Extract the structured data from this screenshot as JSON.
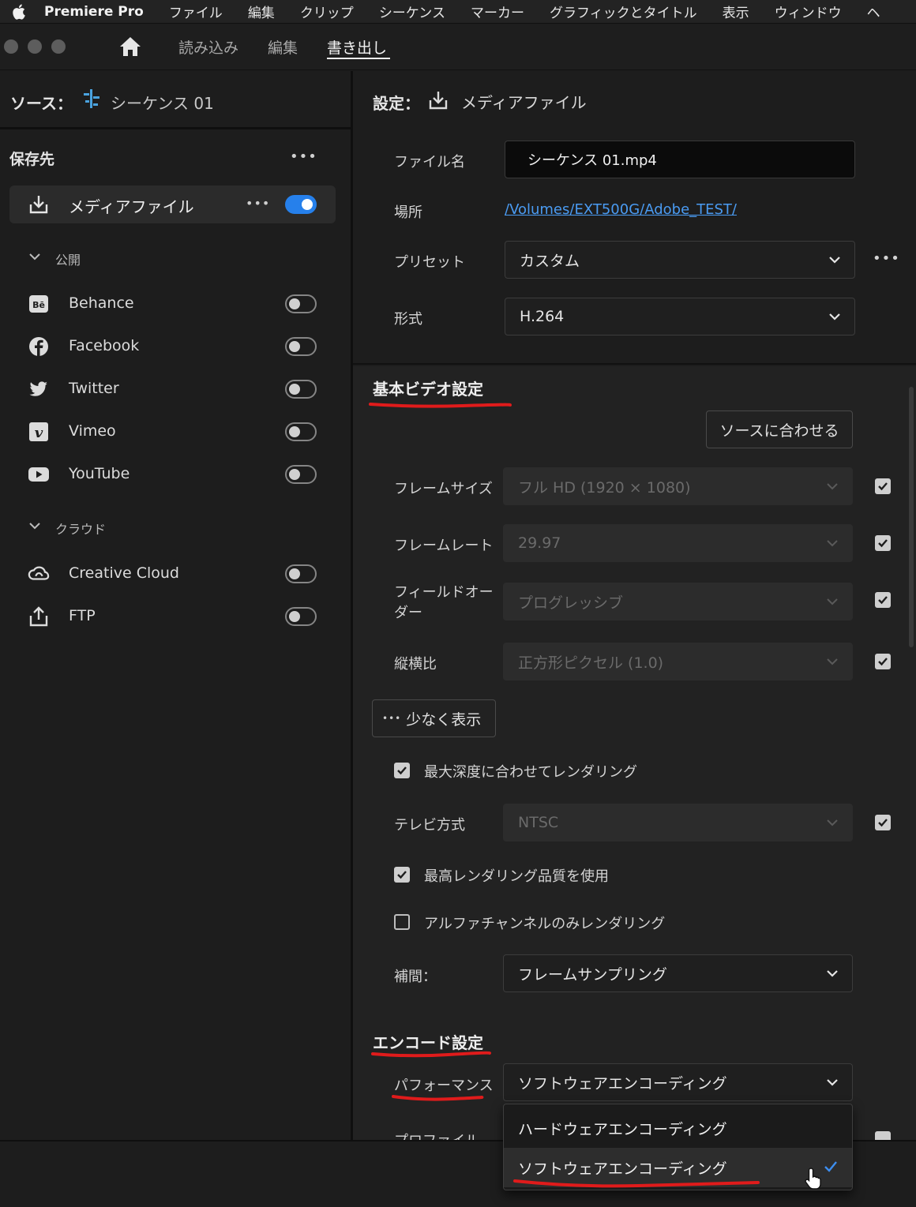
{
  "menubar": {
    "app_name": "Premiere Pro",
    "items": [
      "ファイル",
      "編集",
      "クリップ",
      "シーケンス",
      "マーカー",
      "グラフィックとタイトル",
      "表示",
      "ウィンドウ",
      "ヘ"
    ]
  },
  "header": {
    "tabs": [
      {
        "label": "読み込み"
      },
      {
        "label": "編集"
      },
      {
        "label": "書き出し",
        "active": true
      }
    ]
  },
  "source": {
    "label": "ソース：",
    "value": "シーケンス 01"
  },
  "destinations": {
    "title": "保存先",
    "media_file": {
      "label": "メディアファイル",
      "enabled": true
    },
    "publish_group": "公開",
    "publish": [
      {
        "label": "Behance",
        "icon": "behance-icon",
        "enabled": false
      },
      {
        "label": "Facebook",
        "icon": "facebook-icon",
        "enabled": false
      },
      {
        "label": "Twitter",
        "icon": "twitter-icon",
        "enabled": false
      },
      {
        "label": "Vimeo",
        "icon": "vimeo-icon",
        "enabled": false
      },
      {
        "label": "YouTube",
        "icon": "youtube-icon",
        "enabled": false
      }
    ],
    "cloud_group": "クラウド",
    "cloud": [
      {
        "label": "Creative Cloud",
        "icon": "creative-cloud-icon",
        "enabled": false
      },
      {
        "label": "FTP",
        "icon": "ftp-upload-icon",
        "enabled": false
      }
    ]
  },
  "settings": {
    "label": "設定：",
    "target": "メディアファイル",
    "filename_label": "ファイル名",
    "filename": "シーケンス 01.mp4",
    "location_label": "場所",
    "location": "/Volumes/EXT500G/Adobe_TEST/",
    "preset_label": "プリセット",
    "preset": "カスタム",
    "format_label": "形式",
    "format": "H.264"
  },
  "video": {
    "title": "基本ビデオ設定",
    "match_source": "ソースに合わせる",
    "frame_size_label": "フレームサイズ",
    "frame_size": "フル HD (1920 × 1080)",
    "frame_rate_label": "フレームレート",
    "frame_rate": "29.97",
    "field_order_label": "フィールドオー\nダー",
    "field_order": "プログレッシブ",
    "aspect_label": "縦横比",
    "aspect": "正方形ピクセル (1.0)",
    "show_less": "少なく表示",
    "max_depth": {
      "label": "最大深度に合わせてレンダリング",
      "checked": true
    },
    "tv_label": "テレビ方式",
    "tv": "NTSC",
    "max_quality": {
      "label": "最高レンダリング品質を使用",
      "checked": true
    },
    "alpha_only": {
      "label": "アルファチャンネルのみレンダリング",
      "checked": false
    },
    "interp_label": "補間：",
    "interp": "フレームサンプリング"
  },
  "encode": {
    "title": "エンコード設定",
    "performance_label": "パフォーマンス",
    "performance": "ソフトウェアエンコーディング",
    "profile_label": "プロファイル",
    "options": [
      {
        "label": "ハードウェアエンコーディング",
        "selected": false
      },
      {
        "label": "ソフトウェアエンコーディング",
        "selected": true
      }
    ]
  },
  "colors": {
    "accent": "#2680eb",
    "link": "#4a9bf2",
    "annotation": "#e01b1b"
  }
}
